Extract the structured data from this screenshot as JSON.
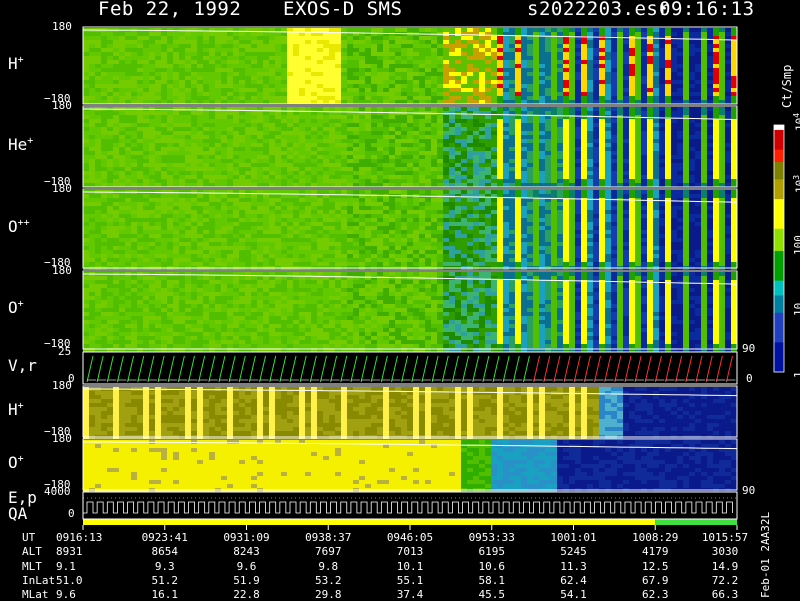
{
  "header": {
    "date": "Feb 22, 1992",
    "instrument": "EXOS-D SMS",
    "file": "s2022203.esr",
    "time": "09:16:13"
  },
  "panels": [
    {
      "label": "H",
      "sup": "+",
      "ymax": "180",
      "ymin": "−180",
      "colormap": "energy"
    },
    {
      "label": "He",
      "sup": "+",
      "ymax": "180",
      "ymin": "−180",
      "colormap": "energy"
    },
    {
      "label": "O",
      "sup": "++",
      "ymax": "180",
      "ymin": "−180",
      "colormap": "energy"
    },
    {
      "label": "O",
      "sup": "+",
      "ymax": "180",
      "ymin": "−180",
      "colormap": "energy"
    },
    {
      "label": "V,r",
      "sup": "",
      "ymax": "25",
      "ymin": "0",
      "right_max": "90",
      "right_min": "0"
    },
    {
      "label": "H",
      "sup": "+",
      "ymax": "180",
      "ymin": "−180",
      "colormap": "velocity"
    },
    {
      "label": "O",
      "sup": "+",
      "ymax": "180",
      "ymin": "−180",
      "colormap": "velocity",
      "right_max": "90"
    },
    {
      "label": "E,p",
      "label2": "QA",
      "ymax": "4000",
      "ymin": "0"
    }
  ],
  "colorbar": {
    "unit": "Ct/Smp",
    "ticks": [
      {
        "base": "10",
        "exp": "4",
        "decade": 4
      },
      {
        "base": "10",
        "exp": "3",
        "decade": 3
      },
      {
        "base": "100",
        "exp": "",
        "decade": 2
      },
      {
        "base": "10",
        "exp": "",
        "decade": 1
      },
      {
        "base": "1",
        "exp": "",
        "decade": 0
      }
    ]
  },
  "side_annotation": "Feb-01 2AA32L",
  "footer": {
    "rows": [
      {
        "label": "UT",
        "values": [
          "0916:13",
          "0923:41",
          "0931:09",
          "0938:37",
          "0946:05",
          "0953:33",
          "1001:01",
          "1008:29",
          "1015:57"
        ]
      },
      {
        "label": "ALT",
        "values": [
          "8931",
          "8654",
          "8243",
          "7697",
          "7013",
          "6195",
          "5245",
          "4179",
          "3030"
        ]
      },
      {
        "label": "MLT",
        "values": [
          "9.1",
          "9.3",
          "9.6",
          "9.8",
          "10.1",
          "10.6",
          "11.3",
          "12.5",
          "14.9"
        ]
      },
      {
        "label": "InLat",
        "values": [
          "51.0",
          "51.2",
          "51.9",
          "53.2",
          "55.1",
          "58.1",
          "62.4",
          "67.9",
          "72.2"
        ]
      },
      {
        "label": "MLat",
        "values": [
          "9.6",
          "16.1",
          "22.8",
          "29.8",
          "37.4",
          "45.5",
          "54.1",
          "62.3",
          "66.3"
        ]
      }
    ]
  },
  "chart_data": {
    "type": "heatmap",
    "title": "Feb 22, 1992   EXOS-D SMS",
    "xlabel": "UT",
    "x_ticks": [
      "0916:13",
      "0923:41",
      "0931:09",
      "0938:37",
      "0946:05",
      "0953:33",
      "1001:01",
      "1008:29",
      "1015:57"
    ],
    "color_scale": {
      "unit": "Ct/Smp",
      "scale": "log",
      "range": [
        1,
        10000
      ]
    },
    "panels": [
      {
        "species": "H+",
        "yrange": [
          -180,
          180
        ]
      },
      {
        "species": "He+",
        "yrange": [
          -180,
          180
        ]
      },
      {
        "species": "O++",
        "yrange": [
          -180,
          180
        ]
      },
      {
        "species": "O+",
        "yrange": [
          -180,
          180
        ]
      },
      {
        "species": "V,r",
        "yrange": [
          0,
          25
        ],
        "right_range": [
          0,
          90
        ]
      },
      {
        "species": "H+",
        "yrange": [
          -180,
          180
        ]
      },
      {
        "species": "O+",
        "yrange": [
          -180,
          180
        ],
        "right_range": [
          null,
          90
        ]
      },
      {
        "species": "E,p / QA",
        "yrange": [
          0,
          4000
        ]
      }
    ]
  }
}
